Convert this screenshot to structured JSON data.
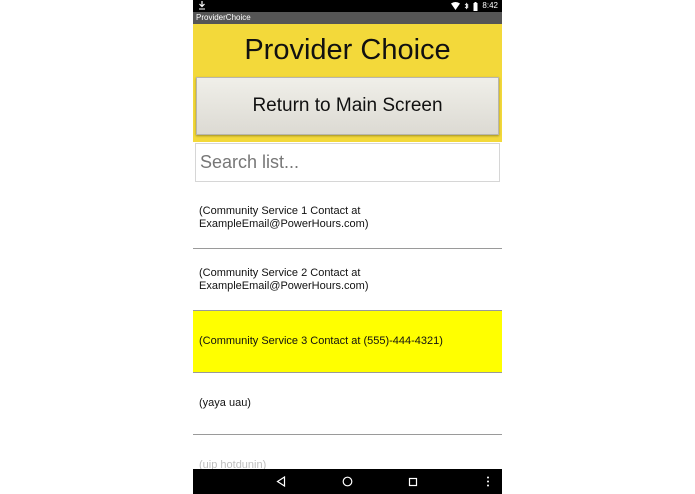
{
  "status_bar": {
    "time": "8:42"
  },
  "window_title": "ProviderChoice",
  "header": {
    "title": "Provider Choice",
    "return_label": "Return to Main Screen"
  },
  "search": {
    "placeholder": "Search list...",
    "value": ""
  },
  "list": {
    "items": [
      {
        "line1": "(Community Service 1 Contact at",
        "line2": "ExampleEmail@PowerHours.com)"
      },
      {
        "line1": "(Community Service 2 Contact at",
        "line2": "ExampleEmail@PowerHours.com)"
      },
      {
        "line1": "(Community Service 3 Contact at (555)-444-4321)",
        "line2": ""
      },
      {
        "line1": "(yaya uau)",
        "line2": ""
      },
      {
        "line1": "(uip hotdunin)",
        "line2": ""
      }
    ],
    "selected_index": 2
  },
  "colors": {
    "header_bg": "#f3d93a",
    "selected_bg": "#ffff00",
    "status_bar_bg": "#000000",
    "title_bar_bg": "#555555"
  },
  "icons": {
    "status_left": "download-icon",
    "status_right": [
      "wifi-icon",
      "bluetooth-icon",
      "battery-icon"
    ],
    "nav": [
      "back-icon",
      "home-icon",
      "recents-icon",
      "menu-icon"
    ]
  }
}
